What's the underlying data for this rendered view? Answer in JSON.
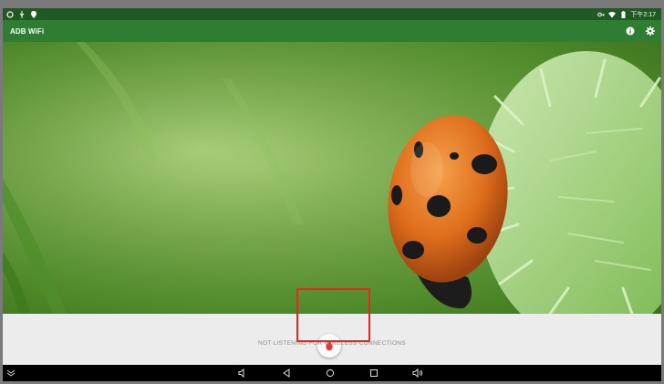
{
  "status_bar": {
    "time": "下午2:17",
    "left_icons": [
      "sync-icon",
      "usb-icon",
      "location-icon"
    ],
    "right_icons": [
      "vpn-key-icon",
      "wifi-icon",
      "battery-icon"
    ]
  },
  "app_bar": {
    "title": "ADB WiFi",
    "actions": [
      {
        "name": "info-icon"
      },
      {
        "name": "settings-icon"
      }
    ]
  },
  "main": {
    "hero_image": "ladybug-on-grass-photo",
    "toggle_button_icon": "bug-icon",
    "status_message": "NOT LISTENING FOR WIRELESS CONNECTIONS"
  },
  "nav_bar": {
    "buttons": [
      "collapse-icon",
      "volume-down-icon",
      "back-icon",
      "home-icon",
      "recents-icon",
      "volume-up-icon"
    ]
  },
  "colors": {
    "status_bar": "#1f5a23",
    "app_bar": "#2e7d32",
    "bug_icon": "#e53935",
    "highlight": "#e5281f",
    "panel": "#ececec"
  }
}
